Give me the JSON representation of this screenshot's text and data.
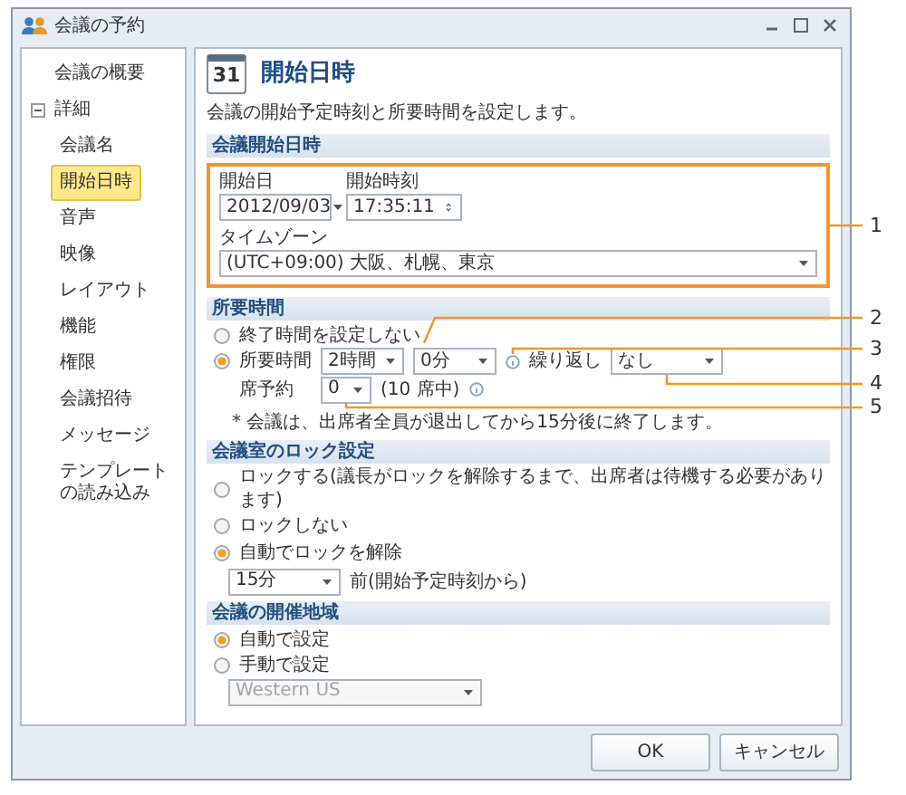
{
  "window": {
    "title": "会議の予約"
  },
  "sidebar": {
    "items": [
      {
        "label": "会議の概要",
        "selected": false
      },
      {
        "label": "詳細",
        "selected": false,
        "expanded": true,
        "children": [
          {
            "label": "会議名",
            "selected": false
          },
          {
            "label": "開始日時",
            "selected": true
          },
          {
            "label": "音声",
            "selected": false
          },
          {
            "label": "映像",
            "selected": false
          },
          {
            "label": "レイアウト",
            "selected": false
          },
          {
            "label": "機能",
            "selected": false
          },
          {
            "label": "権限",
            "selected": false
          },
          {
            "label": "会議招待",
            "selected": false
          },
          {
            "label": "メッセージ",
            "selected": false
          },
          {
            "label": "テンプレートの読み込み",
            "selected": false
          }
        ]
      }
    ]
  },
  "page": {
    "title": "開始日時",
    "icon_text": "31",
    "description": "会議の開始予定時刻と所要時間を設定します。"
  },
  "sections": [
    {
      "kind": "start",
      "title": "会議開始日時",
      "date_label": "開始日",
      "date_value": "2012/09/03",
      "time_label": "開始時刻",
      "time_value": "17:35:11",
      "timezone_label": "タイムゾーン",
      "timezone_value": "(UTC+09:00) 大阪、札幌、東京"
    },
    {
      "kind": "duration",
      "title": "所要時間",
      "options": [
        {
          "label": "終了時間を設定しない",
          "selected": false
        },
        {
          "label": "所要時間",
          "selected": true
        }
      ],
      "hours": "2時間",
      "minutes": "0分",
      "repeat_label": "繰り返し",
      "repeat_value": "なし",
      "seat_label": "席予約",
      "seat_value": "0",
      "seat_total": "(10 席中)",
      "note": "* 会議は、出席者全員が退出してから15分後に終了します。"
    },
    {
      "kind": "lock",
      "title": "会議室のロック設定",
      "options": [
        {
          "label": "ロックする(議長がロックを解除するまで、出席者は待機する必要があります)",
          "selected": false
        },
        {
          "label": "ロックしない",
          "selected": false
        },
        {
          "label": "自動でロックを解除",
          "selected": true
        }
      ],
      "unlock_value": "15分",
      "unlock_suffix": "前(開始予定時刻から)"
    },
    {
      "kind": "region",
      "title": "会議の開催地域",
      "options": [
        {
          "label": "自動で設定",
          "selected": true
        },
        {
          "label": "手動で設定",
          "selected": false
        }
      ],
      "region_value": "Western US",
      "region_disabled": true
    }
  ],
  "buttons": [
    {
      "label": "OK"
    },
    {
      "label": "キャンセル"
    }
  ],
  "callouts": [
    {
      "label": "1"
    },
    {
      "label": "2"
    },
    {
      "label": "3"
    },
    {
      "label": "4"
    },
    {
      "label": "5"
    }
  ]
}
